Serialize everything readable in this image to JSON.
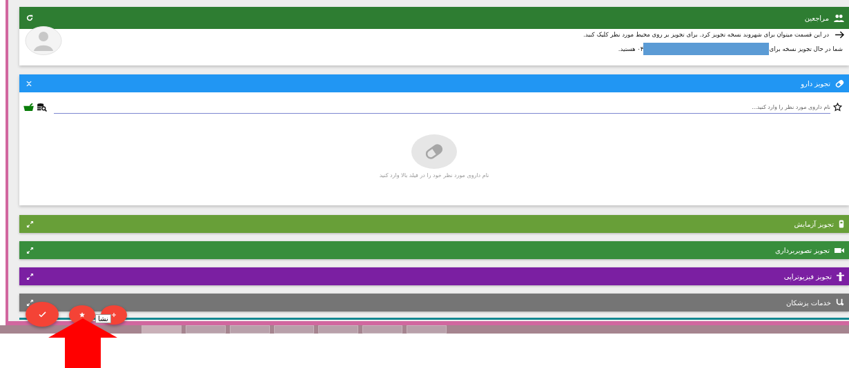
{
  "patients_panel": {
    "title": "مراجعین",
    "hint": "در این قسمت میتوان برای شهروند نسخه تجویز کرد. برای تجویز بر روی محیط مورد نظر کلیک کنید.",
    "status_prefix": "شما در حال تجویز نسخه برای",
    "status_suffix": "۰۴ هستید."
  },
  "drug_panel": {
    "title": "تجویز دارو",
    "expanded": true,
    "search": {
      "placeholder": "نام داروی مورد نظر را وارد کنید..."
    },
    "empty_message": "نام داروی مورد نظر خود را در فیلد بالا وارد کنید"
  },
  "collapsed_panels": [
    {
      "title": "تجویز آزمایش",
      "color": "#689f38",
      "expanded": false
    },
    {
      "title": "تجویز تصویربرداری",
      "color": "#388e3c",
      "expanded": false
    },
    {
      "title": "تجویز فیزیوتراپی",
      "color": "#7b1fa2",
      "expanded": false
    },
    {
      "title": "خدمات پزشکان",
      "color": "#757575",
      "expanded": false
    }
  ],
  "tooltip": "نشا"
}
